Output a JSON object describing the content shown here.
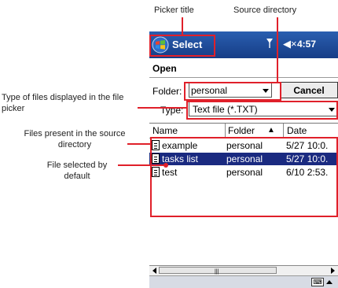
{
  "callouts": {
    "picker_title": "Picker title",
    "source_directory": "Source directory",
    "type_of_files": "Type of files displayed in the file picker",
    "files_present": "Files present in the source directory",
    "file_selected": "File selected by default"
  },
  "titlebar": {
    "title": "Select",
    "signal_icon": "signal-antenna-icon",
    "speaker_icon": "speaker-muted-icon",
    "speaker_glyph": "◀×",
    "time": "4:57"
  },
  "dialog": {
    "open_label": "Open",
    "folder_label": "Folder:",
    "folder_value": "personal",
    "cancel_label": "Cancel",
    "type_label": "Type:",
    "type_value": "Text file (*.TXT)"
  },
  "file_list": {
    "columns": [
      "Name",
      "Folder",
      "Date"
    ],
    "sort_indicator": "▲",
    "rows": [
      {
        "name": "example",
        "folder": "personal",
        "date": "5/27 10:0."
      },
      {
        "name": "tasks list",
        "folder": "personal",
        "date": "5/27 10:0."
      },
      {
        "name": "test",
        "folder": "personal",
        "date": "6/10 2:53."
      }
    ],
    "selected_index": 1
  },
  "scrollbar": {
    "grip": "|||"
  },
  "sip": {
    "keyboard_icon": "keyboard-icon",
    "keyboard_glyph": "⌨"
  },
  "colors": {
    "annotation": "#e0202a",
    "titlebar": "#163d86",
    "selection": "#1a2a80"
  }
}
